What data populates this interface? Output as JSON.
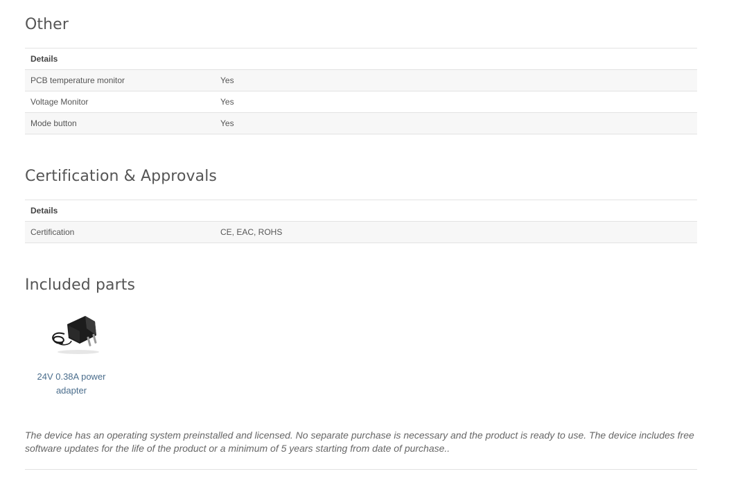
{
  "sections": {
    "other": {
      "title": "Other",
      "header": "Details",
      "rows": [
        {
          "key": "PCB temperature monitor",
          "value": "Yes"
        },
        {
          "key": "Voltage Monitor",
          "value": "Yes"
        },
        {
          "key": "Mode button",
          "value": "Yes"
        }
      ]
    },
    "certification": {
      "title": "Certification & Approvals",
      "header": "Details",
      "rows": [
        {
          "key": "Certification",
          "value": "CE, EAC, ROHS"
        }
      ]
    },
    "included_parts": {
      "title": "Included parts",
      "items": [
        {
          "label": "24V 0.38A power adapter",
          "icon": "power-adapter-icon"
        }
      ]
    }
  },
  "footer_note": "The device has an operating system preinstalled and licensed. No separate purchase is necessary and the product is ready to use. The device includes free software updates for the life of the product or a minimum of 5 years starting from date of purchase..",
  "colors": {
    "heading": "#555555",
    "link": "#4a6d8c",
    "row_alt": "#f7f7f7",
    "border": "#e2e2e2"
  }
}
